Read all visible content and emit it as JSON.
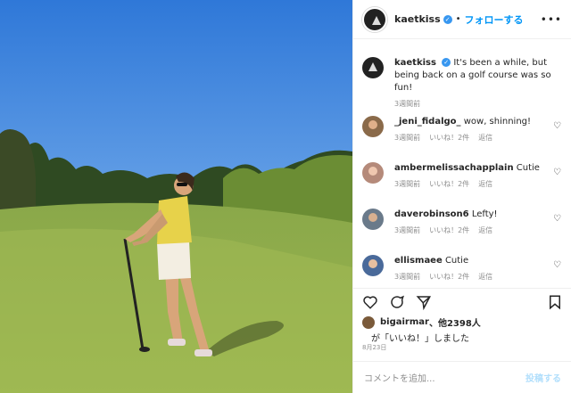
{
  "post": {
    "username": "kaetkiss",
    "follow_label": "フォローする",
    "dot": "•",
    "more": "•••",
    "caption": "It's been a while, but being back on a golf course was so fun!",
    "caption_time": "3週間前"
  },
  "comments": [
    {
      "user": "_jeni_fidalgo_",
      "text": "wow, shinning!",
      "time": "3週間前",
      "likes": "いいね！2件",
      "reply": "返信"
    },
    {
      "user": "ambermelissachapplain",
      "text": "Cutie",
      "time": "3週間前",
      "likes": "いいね！2件",
      "reply": "返信"
    },
    {
      "user": "daverobinson6",
      "text": "Lefty!",
      "time": "3週間前",
      "likes": "いいね！2件",
      "reply": "返信"
    },
    {
      "user": "ellismaee",
      "text": "Cutie",
      "time": "3週間前",
      "likes": "いいね！2件",
      "reply": "返信"
    }
  ],
  "likes": {
    "line1_user": "bigairmar",
    "line1_rest": "、他2398人",
    "line2": "が「いいね！」しました"
  },
  "date": "8月23日",
  "add_comment": {
    "placeholder": "コメントを追加...",
    "post_label": "投稿する"
  },
  "icons": [
    "heart-icon",
    "comment-icon",
    "share-icon",
    "bookmark-icon",
    "verified-icon",
    "more-icon"
  ]
}
